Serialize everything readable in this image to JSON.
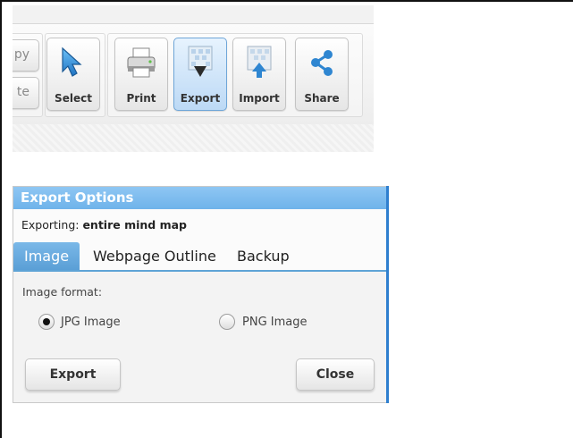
{
  "toolbar": {
    "copy_label": "py",
    "paste_label": "te",
    "select_label": "Select",
    "print_label": "Print",
    "export_label": "Export",
    "import_label": "Import",
    "share_label": "Share",
    "active_button": "Export"
  },
  "dialog": {
    "title": "Export Options",
    "exporting_prefix": "Exporting:",
    "exporting_value": "entire mind map",
    "tabs": [
      {
        "label": "Image",
        "active": true
      },
      {
        "label": "Webpage Outline",
        "active": false
      },
      {
        "label": "Backup",
        "active": false
      }
    ],
    "image_format_label": "Image format:",
    "options": [
      {
        "label": "JPG Image",
        "selected": true
      },
      {
        "label": "PNG Image",
        "selected": false
      }
    ],
    "export_button": "Export",
    "close_button": "Close"
  },
  "colors": {
    "title_bar": "#7ab8ec",
    "active_tab": "#5a9fd6",
    "active_toolbar_button": "#bcd9f5",
    "icon_blue": "#2f86d1"
  }
}
